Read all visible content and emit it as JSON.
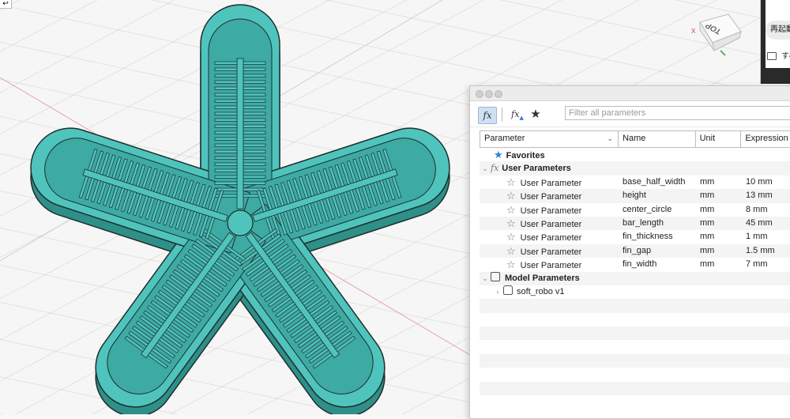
{
  "viewport": {
    "viewcube_label": "TOP",
    "model_color": "#4fc4bd",
    "corner_glyph": "↩"
  },
  "side_app": {
    "restart_label": "再起動",
    "folder_label": "すべ"
  },
  "dialog": {
    "filter_placeholder": "Filter all parameters",
    "toolbar": {
      "fx_label": "fx",
      "add_user_param_label": "fx",
      "favorites_icon": "star-icon"
    },
    "columns": {
      "parameter": "Parameter",
      "name": "Name",
      "unit": "Unit",
      "expression": "Expression"
    },
    "groups": {
      "favorites": "Favorites",
      "user_parameters": "User Parameters",
      "model_parameters": "Model Parameters"
    },
    "user_params": [
      {
        "type": "User Parameter",
        "name": "base_half_width",
        "unit": "mm",
        "expression": "10 mm"
      },
      {
        "type": "User Parameter",
        "name": "height",
        "unit": "mm",
        "expression": "13 mm"
      },
      {
        "type": "User Parameter",
        "name": "center_circle",
        "unit": "mm",
        "expression": "8 mm"
      },
      {
        "type": "User Parameter",
        "name": "bar_length",
        "unit": "mm",
        "expression": "45 mm"
      },
      {
        "type": "User Parameter",
        "name": "fin_thickness",
        "unit": "mm",
        "expression": "1 mm"
      },
      {
        "type": "User Parameter",
        "name": "fin_gap",
        "unit": "mm",
        "expression": "1.5 mm"
      },
      {
        "type": "User Parameter",
        "name": "fin_width",
        "unit": "mm",
        "expression": "7 mm"
      }
    ],
    "model_components": [
      {
        "name": "soft_robo v1"
      }
    ]
  }
}
